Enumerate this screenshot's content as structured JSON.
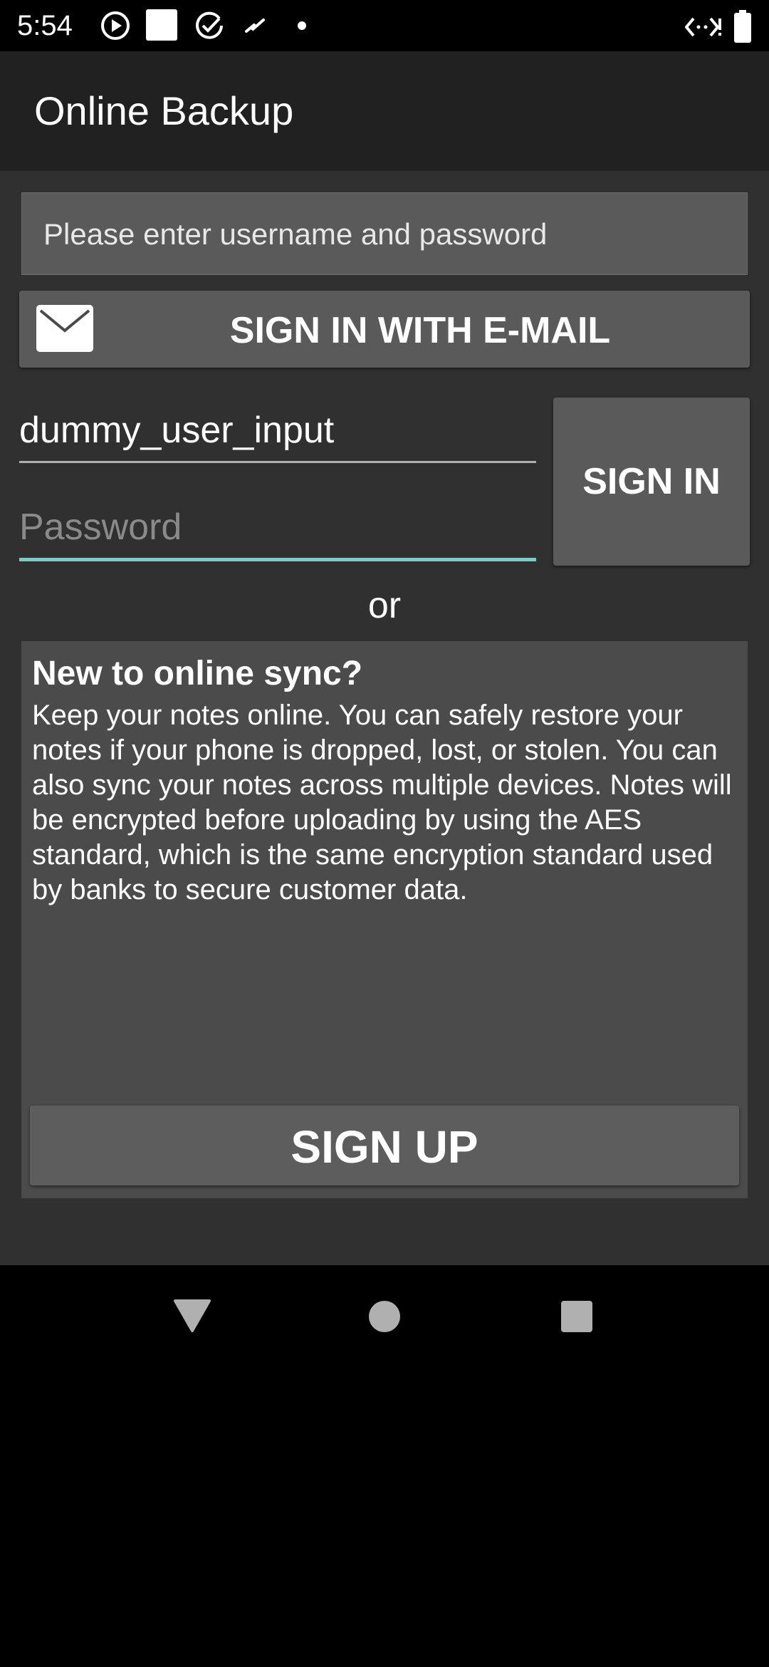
{
  "status_bar": {
    "time": "5:54",
    "icons_left": [
      "play-circle-icon",
      "square-notification-icon",
      "check-circle-icon",
      "squiggle-icon",
      "dot-icon"
    ],
    "icons_right": [
      "data-arrows-icon",
      "battery-icon"
    ]
  },
  "app_bar": {
    "title": "Online Backup"
  },
  "login": {
    "message": "Please enter username and password",
    "email_button_label": "SIGN IN WITH E-MAIL",
    "email_icon": "envelope-icon",
    "username_value": "dummy_user_input",
    "password_placeholder": "Password",
    "sign_in_label": "SIGN IN",
    "or_text": "or"
  },
  "signup_info": {
    "heading": "New to online sync?",
    "body": "Keep your notes online. You can safely restore your notes if your phone is dropped, lost, or stolen. You can also sync your notes across multiple devices. Notes will be encrypted before uploading by using the AES standard, which is the same encryption standard used by banks to secure customer data.",
    "sign_up_label": "SIGN UP"
  },
  "nav_bar": {
    "buttons": [
      "back-icon",
      "home-icon",
      "recents-icon"
    ]
  },
  "colors": {
    "app_bar": "#212121",
    "content_bg": "#303030",
    "button_bg": "#5a5a5a",
    "accent_underline": "#80cbc4"
  }
}
